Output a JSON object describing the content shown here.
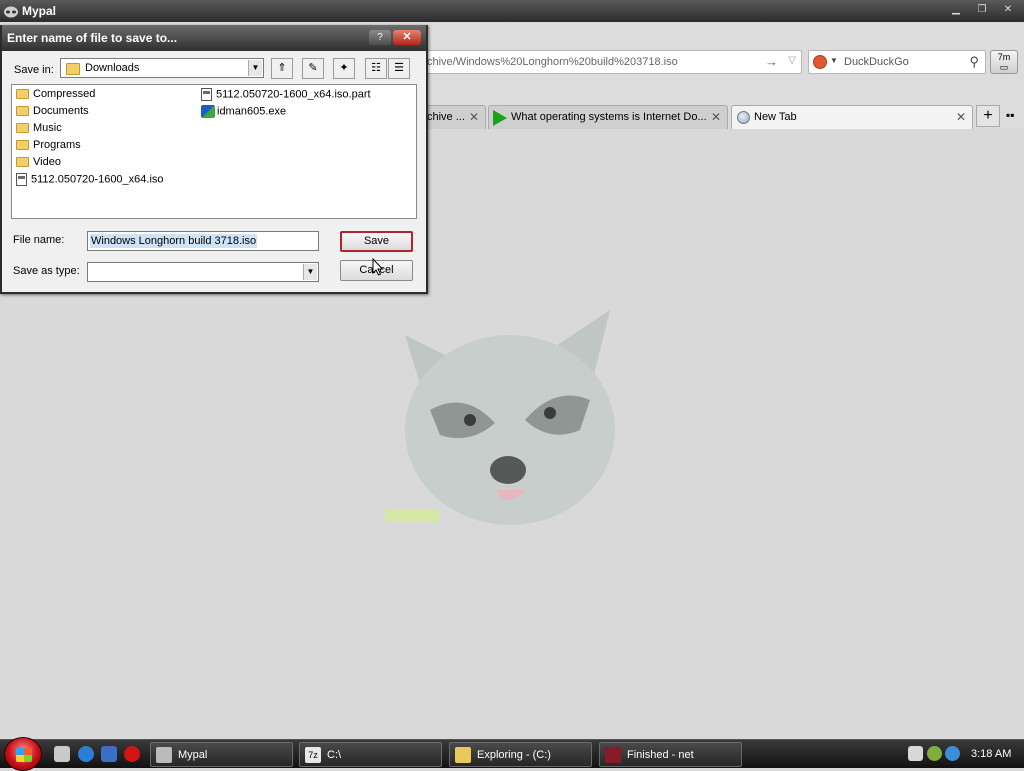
{
  "window": {
    "title": "Mypal",
    "controls": [
      "minimize-icon",
      "restore-icon",
      "close-icon"
    ]
  },
  "toolbar": {
    "url": "chive/Windows%20Longhorn%20build%203718.iso",
    "search_engine": "DuckDuckGo",
    "addon_badge": "7m"
  },
  "tabs": [
    {
      "label": "chive ...",
      "active": false
    },
    {
      "label": "What operating systems is Internet Do...",
      "active": false
    },
    {
      "label": "New Tab",
      "active": true
    }
  ],
  "dialog": {
    "title": "Enter name of file to save to...",
    "help_label": "?",
    "close_label": "✕",
    "save_in_label": "Save in:",
    "save_in_value": "Downloads",
    "files_col1": [
      {
        "name": "Compressed",
        "type": "folder"
      },
      {
        "name": "Documents",
        "type": "folder"
      },
      {
        "name": "Music",
        "type": "folder"
      },
      {
        "name": "Programs",
        "type": "folder"
      },
      {
        "name": "Video",
        "type": "folder"
      },
      {
        "name": "5112.050720-1600_x64.iso",
        "type": "file"
      }
    ],
    "files_col2": [
      {
        "name": "5112.050720-1600_x64.iso.part",
        "type": "file"
      },
      {
        "name": "idman605.exe",
        "type": "exe"
      }
    ],
    "file_name_label": "File name:",
    "file_name_value": "Windows Longhorn build 3718.iso",
    "save_type_label": "Save as type:",
    "save_type_value": "",
    "save_button": "Save",
    "cancel_button": "Cancel"
  },
  "taskbar": {
    "buttons": [
      {
        "label": "Mypal"
      },
      {
        "label": "C:\\"
      },
      {
        "label": "Exploring - (C:)"
      },
      {
        "label": "Finished - net"
      }
    ],
    "clock": "3:18 AM"
  },
  "colors": {
    "default_button_border": "#b0242f",
    "dialog_close": "#b1261b",
    "selection": "#cde3f8"
  }
}
